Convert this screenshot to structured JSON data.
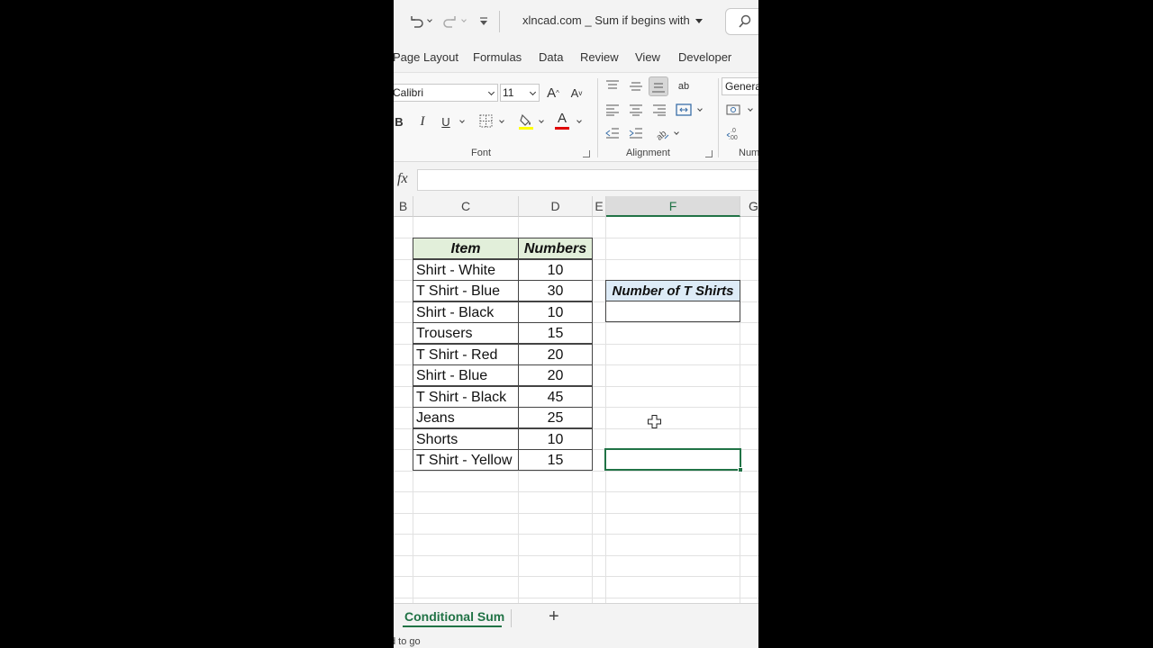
{
  "titlebar": {
    "doc_title": "xlncad.com _ Sum if begins with"
  },
  "ribbon_tabs": [
    "Page Layout",
    "Formulas",
    "Data",
    "Review",
    "View",
    "Developer"
  ],
  "font_group": {
    "font_name": "Calibri",
    "font_size": "11",
    "grow_label": "A",
    "shrink_label": "A",
    "bold_label": "B",
    "italic_label": "I",
    "underline_label": "U",
    "font_color_label": "A",
    "group_label": "Font",
    "fill_color": "#ffff00",
    "font_color": "#e00000"
  },
  "alignment_group": {
    "group_label": "Alignment",
    "wrap_label": "ab"
  },
  "number_group": {
    "format": "General",
    "group_label": "Num"
  },
  "formula_bar": {
    "fx_label": "fx",
    "value": ""
  },
  "columns": [
    "B",
    "C",
    "D",
    "E",
    "F",
    "G"
  ],
  "table": {
    "headers": [
      "Item",
      "Numbers"
    ],
    "rows": [
      {
        "item": "Shirt - White",
        "number": "10"
      },
      {
        "item": "T Shirt - Blue",
        "number": "30"
      },
      {
        "item": "Shirt - Black",
        "number": "10"
      },
      {
        "item": "Trousers",
        "number": "15"
      },
      {
        "item": "T Shirt - Red",
        "number": "20"
      },
      {
        "item": "Shirt - Blue",
        "number": "20"
      },
      {
        "item": "T Shirt - Black",
        "number": "45"
      },
      {
        "item": "Jeans",
        "number": "25"
      },
      {
        "item": "Shorts",
        "number": "10"
      },
      {
        "item": "T Shirt - Yellow",
        "number": "15"
      }
    ]
  },
  "result": {
    "header": "Number of T Shirts",
    "value": ""
  },
  "sheets": {
    "active": "Conditional Sum",
    "add_label": "+"
  },
  "status": {
    "text": "d to go"
  },
  "colors": {
    "accent": "#217346",
    "item_header_bg": "#e2efda",
    "result_header_bg": "#ddebf7"
  }
}
